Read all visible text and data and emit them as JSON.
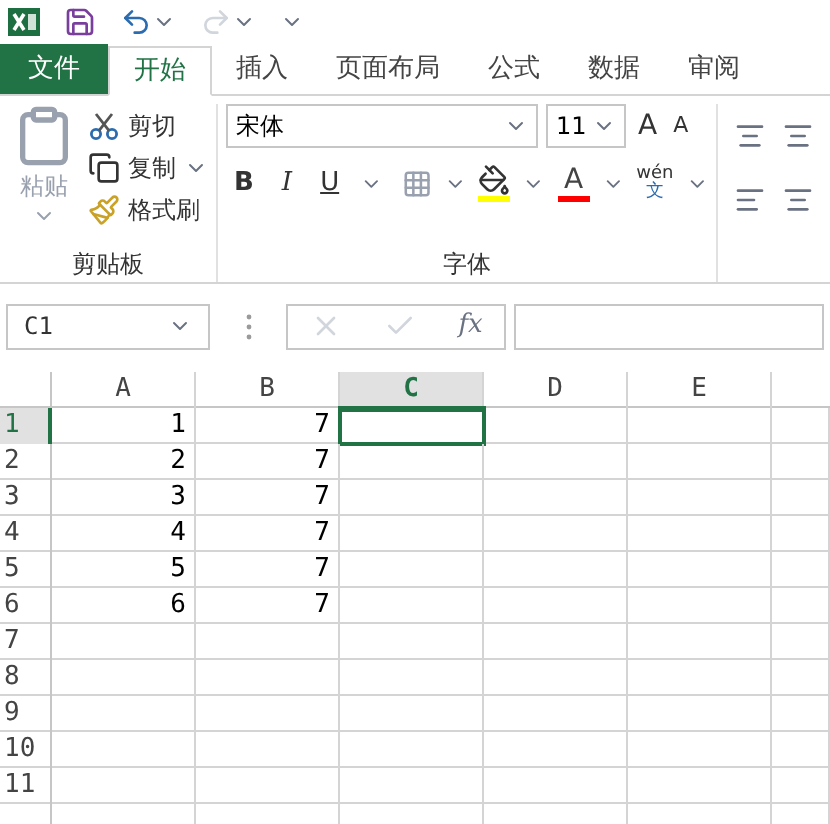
{
  "tabs": [
    {
      "label": "文件",
      "kind": "file",
      "selected": false
    },
    {
      "label": "开始",
      "kind": "tab",
      "selected": true
    },
    {
      "label": "插入",
      "kind": "tab",
      "selected": false
    },
    {
      "label": "页面布局",
      "kind": "tab",
      "selected": false
    },
    {
      "label": "公式",
      "kind": "tab",
      "selected": false
    },
    {
      "label": "数据",
      "kind": "tab",
      "selected": false
    },
    {
      "label": "审阅",
      "kind": "tab",
      "selected": false
    }
  ],
  "clipboard": {
    "paste": "粘贴",
    "cut": "剪切",
    "copy": "复制",
    "format_painter": "格式刷",
    "group_label": "剪贴板"
  },
  "font": {
    "name": "宋体",
    "size": "11",
    "grow": "A",
    "shrink": "A",
    "bold": "B",
    "italic": "I",
    "underline": "U",
    "font_color": "A",
    "phonetic_top": "wén",
    "phonetic_bottom": "文",
    "group_label": "字体"
  },
  "formula_bar": {
    "name_box": "C1",
    "function_button": "fx"
  },
  "grid": {
    "columns": [
      {
        "label": "A",
        "selected": false
      },
      {
        "label": "B",
        "selected": false
      },
      {
        "label": "C",
        "selected": true
      },
      {
        "label": "D",
        "selected": false
      },
      {
        "label": "E",
        "selected": false
      }
    ],
    "rows": [
      {
        "label": "1",
        "selected": true,
        "cells": [
          "1",
          "7"
        ]
      },
      {
        "label": "2",
        "selected": false,
        "cells": [
          "2",
          "7"
        ]
      },
      {
        "label": "3",
        "selected": false,
        "cells": [
          "3",
          "7"
        ]
      },
      {
        "label": "4",
        "selected": false,
        "cells": [
          "4",
          "7"
        ]
      },
      {
        "label": "5",
        "selected": false,
        "cells": [
          "5",
          "7"
        ]
      },
      {
        "label": "6",
        "selected": false,
        "cells": [
          "6",
          "7"
        ]
      },
      {
        "label": "7",
        "selected": false,
        "cells": []
      },
      {
        "label": "8",
        "selected": false,
        "cells": []
      },
      {
        "label": "9",
        "selected": false,
        "cells": []
      },
      {
        "label": "10",
        "selected": false,
        "cells": []
      },
      {
        "label": "11",
        "selected": false,
        "cells": []
      }
    ]
  }
}
